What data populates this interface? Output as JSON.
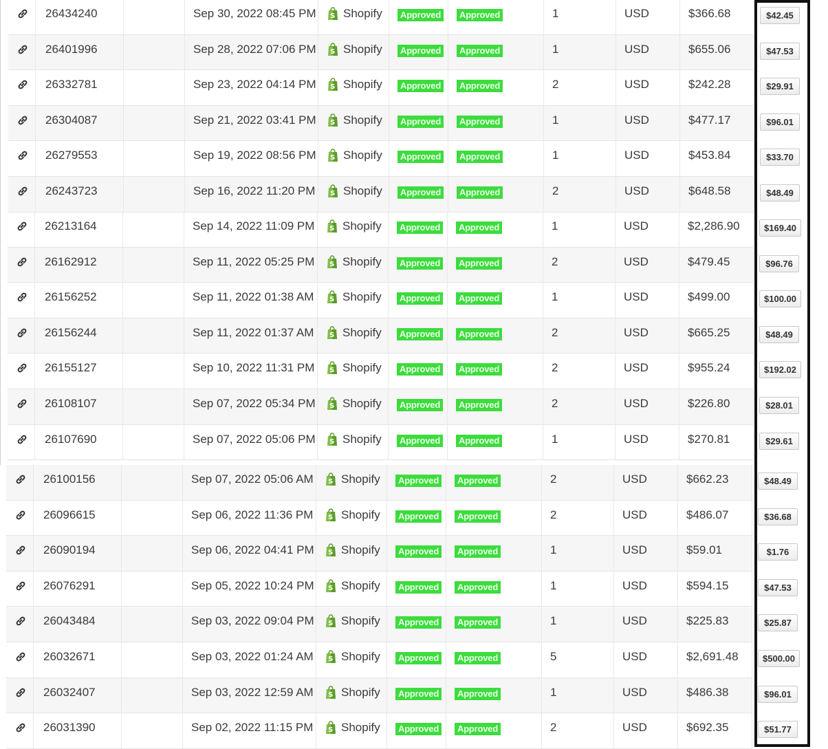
{
  "link_icon": "link-icon",
  "shop_icon": "shopify-bag-icon",
  "colors": {
    "approved": "#3ddc3d",
    "highlight": "#111111"
  },
  "rows": [
    {
      "id": "26434240",
      "date": "Sep 30, 2022 08:45 PM",
      "platform": "Shopify",
      "status1": "Approved",
      "status2": "Approved",
      "qty": "1",
      "currency": "USD",
      "total": "$366.68",
      "commission": "$42.45"
    },
    {
      "id": "26401996",
      "date": "Sep 28, 2022 07:06 PM",
      "platform": "Shopify",
      "status1": "Approved",
      "status2": "Approved",
      "qty": "1",
      "currency": "USD",
      "total": "$655.06",
      "commission": "$47.53"
    },
    {
      "id": "26332781",
      "date": "Sep 23, 2022 04:14 PM",
      "platform": "Shopify",
      "status1": "Approved",
      "status2": "Approved",
      "qty": "2",
      "currency": "USD",
      "total": "$242.28",
      "commission": "$29.91"
    },
    {
      "id": "26304087",
      "date": "Sep 21, 2022 03:41 PM",
      "platform": "Shopify",
      "status1": "Approved",
      "status2": "Approved",
      "qty": "1",
      "currency": "USD",
      "total": "$477.17",
      "commission": "$96.01"
    },
    {
      "id": "26279553",
      "date": "Sep 19, 2022 08:56 PM",
      "platform": "Shopify",
      "status1": "Approved",
      "status2": "Approved",
      "qty": "1",
      "currency": "USD",
      "total": "$453.84",
      "commission": "$33.70"
    },
    {
      "id": "26243723",
      "date": "Sep 16, 2022 11:20 PM",
      "platform": "Shopify",
      "status1": "Approved",
      "status2": "Approved",
      "qty": "2",
      "currency": "USD",
      "total": "$648.58",
      "commission": "$48.49"
    },
    {
      "id": "26213164",
      "date": "Sep 14, 2022 11:09 PM",
      "platform": "Shopify",
      "status1": "Approved",
      "status2": "Approved",
      "qty": "1",
      "currency": "USD",
      "total": "$2,286.90",
      "commission": "$169.40"
    },
    {
      "id": "26162912",
      "date": "Sep 11, 2022 05:25 PM",
      "platform": "Shopify",
      "status1": "Approved",
      "status2": "Approved",
      "qty": "2",
      "currency": "USD",
      "total": "$479.45",
      "commission": "$96.76"
    },
    {
      "id": "26156252",
      "date": "Sep 11, 2022 01:38 AM",
      "platform": "Shopify",
      "status1": "Approved",
      "status2": "Approved",
      "qty": "1",
      "currency": "USD",
      "total": "$499.00",
      "commission": "$100.00"
    },
    {
      "id": "26156244",
      "date": "Sep 11, 2022 01:37 AM",
      "platform": "Shopify",
      "status1": "Approved",
      "status2": "Approved",
      "qty": "2",
      "currency": "USD",
      "total": "$665.25",
      "commission": "$48.49"
    },
    {
      "id": "26155127",
      "date": "Sep 10, 2022 11:31 PM",
      "platform": "Shopify",
      "status1": "Approved",
      "status2": "Approved",
      "qty": "2",
      "currency": "USD",
      "total": "$955.24",
      "commission": "$192.02"
    },
    {
      "id": "26108107",
      "date": "Sep 07, 2022 05:34 PM",
      "platform": "Shopify",
      "status1": "Approved",
      "status2": "Approved",
      "qty": "2",
      "currency": "USD",
      "total": "$226.80",
      "commission": "$28.01"
    },
    {
      "id": "26107690",
      "date": "Sep 07, 2022 05:06 PM",
      "platform": "Shopify",
      "status1": "Approved",
      "status2": "Approved",
      "qty": "1",
      "currency": "USD",
      "total": "$270.81",
      "commission": "$29.61"
    },
    {
      "id": "26100156",
      "date": "Sep 07, 2022 05:06 AM",
      "platform": "Shopify",
      "status1": "Approved",
      "status2": "Approved",
      "qty": "2",
      "currency": "USD",
      "total": "$662.23",
      "commission": "$48.49"
    },
    {
      "id": "26096615",
      "date": "Sep 06, 2022 11:36 PM",
      "platform": "Shopify",
      "status1": "Approved",
      "status2": "Approved",
      "qty": "2",
      "currency": "USD",
      "total": "$486.07",
      "commission": "$36.68"
    },
    {
      "id": "26090194",
      "date": "Sep 06, 2022 04:41 PM",
      "platform": "Shopify",
      "status1": "Approved",
      "status2": "Approved",
      "qty": "1",
      "currency": "USD",
      "total": "$59.01",
      "commission": "$1.76"
    },
    {
      "id": "26076291",
      "date": "Sep 05, 2022 10:24 PM",
      "platform": "Shopify",
      "status1": "Approved",
      "status2": "Approved",
      "qty": "1",
      "currency": "USD",
      "total": "$594.15",
      "commission": "$47.53"
    },
    {
      "id": "26043484",
      "date": "Sep 03, 2022 09:04 PM",
      "platform": "Shopify",
      "status1": "Approved",
      "status2": "Approved",
      "qty": "1",
      "currency": "USD",
      "total": "$225.83",
      "commission": "$25.87"
    },
    {
      "id": "26032671",
      "date": "Sep 03, 2022 01:24 AM",
      "platform": "Shopify",
      "status1": "Approved",
      "status2": "Approved",
      "qty": "5",
      "currency": "USD",
      "total": "$2,691.48",
      "commission": "$500.00"
    },
    {
      "id": "26032407",
      "date": "Sep 03, 2022 12:59 AM",
      "platform": "Shopify",
      "status1": "Approved",
      "status2": "Approved",
      "qty": "1",
      "currency": "USD",
      "total": "$486.38",
      "commission": "$96.01"
    },
    {
      "id": "26031390",
      "date": "Sep 02, 2022 11:15 PM",
      "platform": "Shopify",
      "status1": "Approved",
      "status2": "Approved",
      "qty": "2",
      "currency": "USD",
      "total": "$692.35",
      "commission": "$51.77"
    }
  ]
}
